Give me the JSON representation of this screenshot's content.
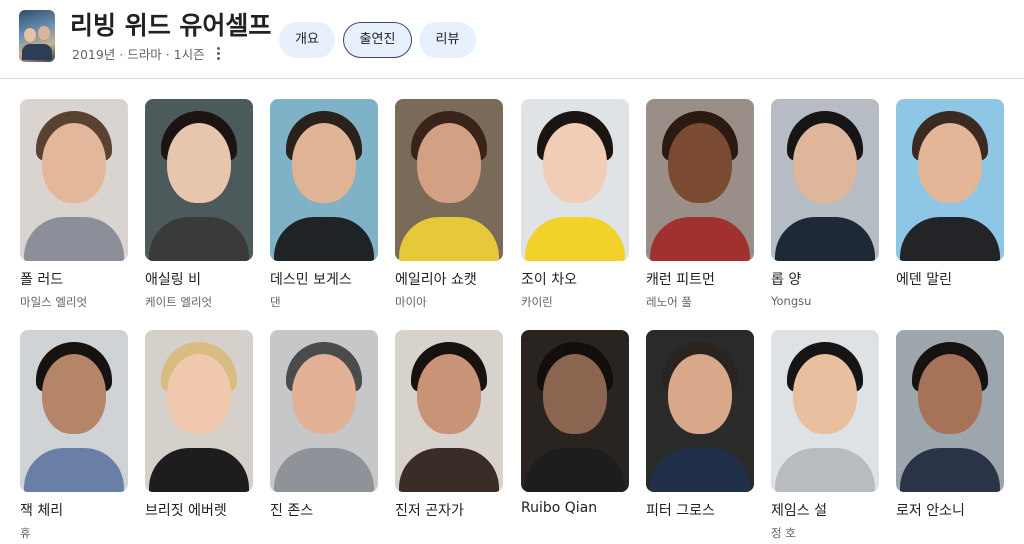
{
  "show": {
    "title": "리빙 위드 유어셀프",
    "meta": "2019년 · 드라마 · 1시즌"
  },
  "tabs": [
    {
      "label": "개요",
      "active": false
    },
    {
      "label": "출연진",
      "active": true
    },
    {
      "label": "리뷰",
      "active": false
    }
  ],
  "cast": [
    {
      "name": "폴 러드",
      "role": "마일스 엘리엇"
    },
    {
      "name": "애실링 비",
      "role": "케이트 엘리엇"
    },
    {
      "name": "데스민 보게스",
      "role": "댄"
    },
    {
      "name": "에일리아 쇼캣",
      "role": "마이아"
    },
    {
      "name": "조이 차오",
      "role": "카이린"
    },
    {
      "name": "캐런 피트먼",
      "role": "레노어 풀"
    },
    {
      "name": "롭 양",
      "role": "Yongsu"
    },
    {
      "name": "에덴 말린",
      "role": ""
    },
    {
      "name": "잭 체리",
      "role": "휴"
    },
    {
      "name": "브리짓 에버렛",
      "role": ""
    },
    {
      "name": "진 존스",
      "role": ""
    },
    {
      "name": "진저 곤자가",
      "role": ""
    },
    {
      "name": "Ruibo Qian",
      "role": ""
    },
    {
      "name": "피터 그로스",
      "role": ""
    },
    {
      "name": "제임스 설",
      "role": "정 호"
    },
    {
      "name": "로저 안소니",
      "role": ""
    }
  ]
}
